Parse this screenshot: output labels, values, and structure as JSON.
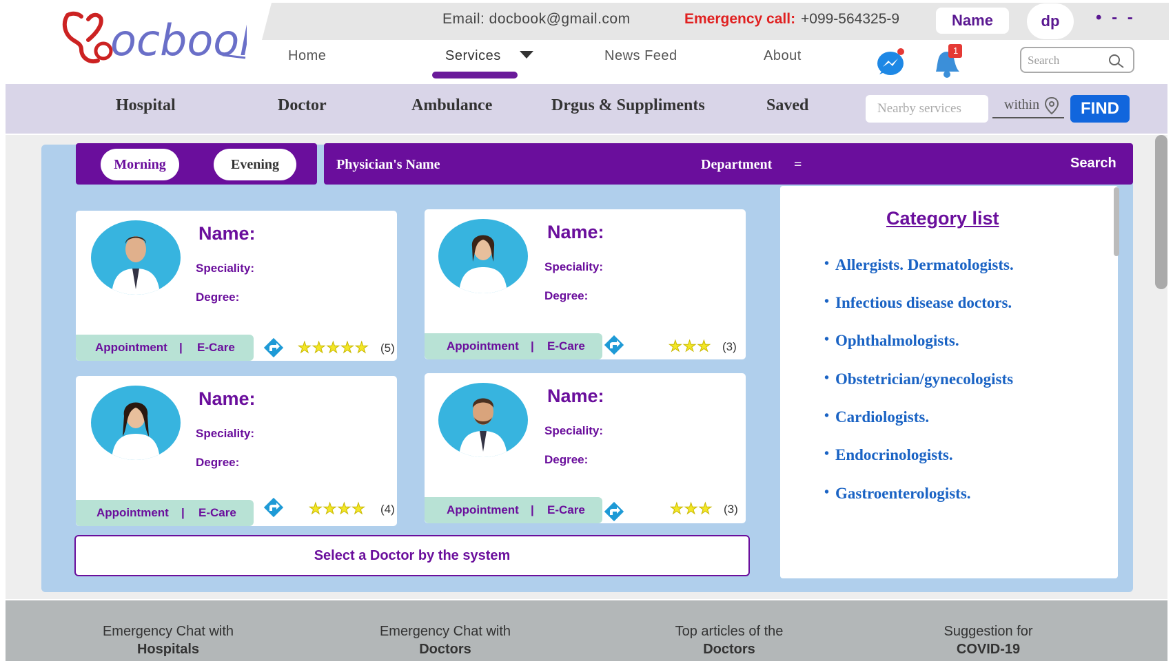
{
  "header": {
    "logo_text": "docbook",
    "email": "Email: docbook@gmail.com",
    "emergency_label": "Emergency call:",
    "emergency_phone": "+099-564325-9",
    "name_button": "Name",
    "dp_button": "dp",
    "more": "• - -"
  },
  "nav": {
    "home": "Home",
    "services": "Services",
    "news_feed": "News Feed",
    "about": "About",
    "notification_count": "1",
    "search_placeholder": "Search"
  },
  "categories": {
    "hospital": "Hospital",
    "doctor": "Doctor",
    "ambulance": "Ambulance",
    "drugs": "Drgus & Suppliments",
    "saved": "Saved",
    "nearby_placeholder": "Nearby services",
    "within": "within",
    "find": "FIND"
  },
  "filters": {
    "morning": "Morning",
    "evening": "Evening",
    "physician_name": "Physician's Name",
    "department": "Department",
    "department_icon": "=",
    "search": "Search"
  },
  "doctors": [
    {
      "name": "Name:",
      "speciality": "Speciality:",
      "degree": "Degree:",
      "appointment": "Appointment",
      "sep": "|",
      "ecare": "E-Care",
      "stars": "★★★★★",
      "rating": "(5)"
    },
    {
      "name": "Name:",
      "speciality": "Speciality:",
      "degree": "Degree:",
      "appointment": "Appointment",
      "sep": "|",
      "ecare": "E-Care",
      "stars": "★★★",
      "rating": "(3)"
    },
    {
      "name": "Name:",
      "speciality": "Speciality:",
      "degree": "Degree:",
      "appointment": "Appointment",
      "sep": "|",
      "ecare": "E-Care",
      "stars": "★★★★",
      "rating": "(4)"
    },
    {
      "name": "Name:",
      "speciality": "Speciality:",
      "degree": "Degree:",
      "appointment": "Appointment",
      "sep": "|",
      "ecare": "E-Care",
      "stars": "★★★",
      "rating": "(3)"
    }
  ],
  "select_doctor": "Select a Doctor by the system",
  "category_list": {
    "title": "Category list",
    "items": [
      "Allergists. Dermatologists.",
      "Infectious disease doctors.",
      "Ophthalmologists.",
      "Obstetrician/gynecologists",
      "Cardiologists.",
      "Endocrinologists.",
      "Gastroenterologists."
    ]
  },
  "footer": [
    {
      "line1": "Emergency Chat with",
      "line2": "Hospitals"
    },
    {
      "line1": "Emergency Chat with",
      "line2": "Doctors"
    },
    {
      "line1": "Top articles of the",
      "line2": "Doctors"
    },
    {
      "line1": "Suggestion for",
      "line2": "COVID-19"
    }
  ],
  "colors": {
    "brand_purple": "#6a0e9c",
    "link_blue": "#1a63c4",
    "find_blue": "#1166dd",
    "emergency_red": "#e02020",
    "avatar_bg": "#37b4df"
  }
}
